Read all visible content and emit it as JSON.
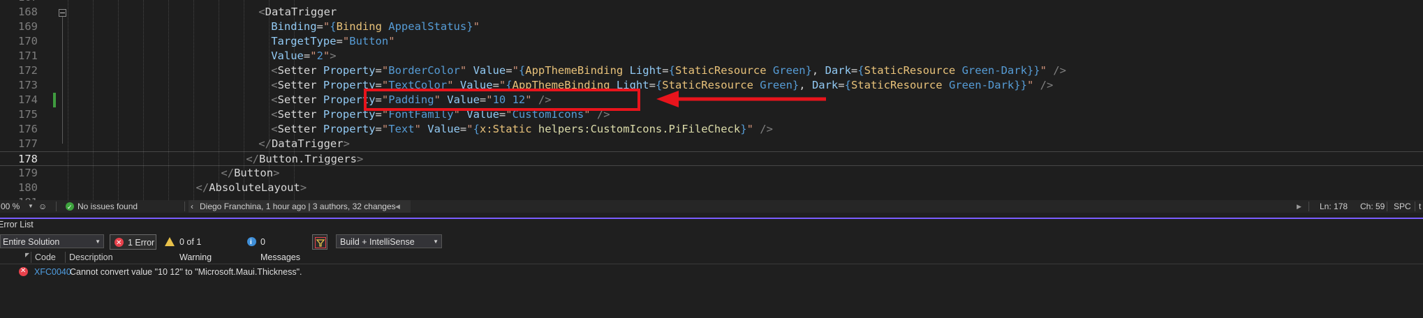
{
  "editor": {
    "lines": [
      {
        "num": "168",
        "indent": 30,
        "tokens": [
          [
            "br",
            "<"
          ],
          [
            "tag",
            "DataTrigger"
          ]
        ]
      },
      {
        "num": "169",
        "indent": 32,
        "tokens": [
          [
            "at",
            "Binding"
          ],
          [
            "eq",
            "="
          ],
          [
            "q",
            "\""
          ],
          [
            "str",
            "{"
          ],
          [
            "ext",
            "Binding"
          ],
          [
            "str",
            " AppealStatus}"
          ],
          [
            "q",
            "\""
          ]
        ]
      },
      {
        "num": "170",
        "indent": 32,
        "tokens": [
          [
            "at",
            "TargetType"
          ],
          [
            "eq",
            "="
          ],
          [
            "q",
            "\""
          ],
          [
            "str",
            "Button"
          ],
          [
            "q",
            "\""
          ]
        ]
      },
      {
        "num": "171",
        "indent": 32,
        "tokens": [
          [
            "at",
            "Value"
          ],
          [
            "eq",
            "="
          ],
          [
            "q",
            "\""
          ],
          [
            "str",
            "2"
          ],
          [
            "q",
            "\""
          ],
          [
            "br",
            ">"
          ]
        ]
      },
      {
        "num": "172",
        "indent": 32,
        "tokens": [
          [
            "br",
            "<"
          ],
          [
            "tag",
            "Setter "
          ],
          [
            "at",
            "Property"
          ],
          [
            "eq",
            "="
          ],
          [
            "q",
            "\""
          ],
          [
            "str",
            "BorderColor"
          ],
          [
            "q",
            "\""
          ],
          [
            "at",
            " Value"
          ],
          [
            "eq",
            "="
          ],
          [
            "q",
            "\""
          ],
          [
            "str",
            "{"
          ],
          [
            "ext",
            "AppThemeBinding"
          ],
          [
            "at",
            " Light"
          ],
          [
            "eq",
            "="
          ],
          [
            "str",
            "{"
          ],
          [
            "ext",
            "StaticResource"
          ],
          [
            "str",
            " Green}"
          ],
          [
            "eq",
            ", "
          ],
          [
            "at",
            "Dark"
          ],
          [
            "eq",
            "="
          ],
          [
            "str",
            "{"
          ],
          [
            "ext",
            "StaticResource"
          ],
          [
            "str",
            " Green-Dark}}"
          ],
          [
            "q",
            "\""
          ],
          [
            "br",
            " />"
          ]
        ]
      },
      {
        "num": "173",
        "indent": 32,
        "tokens": [
          [
            "br",
            "<"
          ],
          [
            "tag",
            "Setter "
          ],
          [
            "at",
            "Property"
          ],
          [
            "eq",
            "="
          ],
          [
            "q",
            "\""
          ],
          [
            "str",
            "TextColor"
          ],
          [
            "q",
            "\""
          ],
          [
            "at",
            " Value"
          ],
          [
            "eq",
            "="
          ],
          [
            "q",
            "\""
          ],
          [
            "str",
            "{"
          ],
          [
            "ext",
            "AppThemeBinding"
          ],
          [
            "at",
            " Light"
          ],
          [
            "eq",
            "="
          ],
          [
            "str",
            "{"
          ],
          [
            "ext",
            "StaticResource"
          ],
          [
            "str",
            " Green}"
          ],
          [
            "eq",
            ", "
          ],
          [
            "at",
            "Dark"
          ],
          [
            "eq",
            "="
          ],
          [
            "str",
            "{"
          ],
          [
            "ext",
            "StaticResource"
          ],
          [
            "str",
            " Green-Dark}}"
          ],
          [
            "q",
            "\""
          ],
          [
            "br",
            " />"
          ]
        ]
      },
      {
        "num": "174",
        "indent": 32,
        "tokens": [
          [
            "br",
            "<"
          ],
          [
            "tag",
            "Setter "
          ],
          [
            "at",
            "Property"
          ],
          [
            "eq",
            "="
          ],
          [
            "q",
            "\""
          ],
          [
            "str",
            "Padding"
          ],
          [
            "q",
            "\""
          ],
          [
            "at",
            " Value"
          ],
          [
            "eq",
            "="
          ],
          [
            "q",
            "\""
          ],
          [
            "str",
            "10 12"
          ],
          [
            "q",
            "\""
          ],
          [
            "br",
            " />"
          ]
        ]
      },
      {
        "num": "175",
        "indent": 32,
        "tokens": [
          [
            "br",
            "<"
          ],
          [
            "tag",
            "Setter "
          ],
          [
            "at",
            "Property"
          ],
          [
            "eq",
            "="
          ],
          [
            "q",
            "\""
          ],
          [
            "str",
            "FontFamily"
          ],
          [
            "q",
            "\""
          ],
          [
            "at",
            " Value"
          ],
          [
            "eq",
            "="
          ],
          [
            "q",
            "\""
          ],
          [
            "str",
            "CustomIcons"
          ],
          [
            "q",
            "\""
          ],
          [
            "br",
            " />"
          ]
        ]
      },
      {
        "num": "176",
        "indent": 32,
        "tokens": [
          [
            "br",
            "<"
          ],
          [
            "tag",
            "Setter "
          ],
          [
            "at",
            "Property"
          ],
          [
            "eq",
            "="
          ],
          [
            "q",
            "\""
          ],
          [
            "str",
            "Text"
          ],
          [
            "q",
            "\""
          ],
          [
            "at",
            " Value"
          ],
          [
            "eq",
            "="
          ],
          [
            "q",
            "\""
          ],
          [
            "str",
            "{"
          ],
          [
            "ext",
            "x:Static"
          ],
          [
            "ext2",
            " helpers:CustomIcons.PiFileCheck"
          ],
          [
            "str",
            "}"
          ],
          [
            "q",
            "\""
          ],
          [
            "br",
            " />"
          ]
        ]
      },
      {
        "num": "177",
        "indent": 30,
        "tokens": [
          [
            "br",
            "</"
          ],
          [
            "tag",
            "DataTrigger"
          ],
          [
            "br",
            ">"
          ]
        ]
      },
      {
        "num": "178",
        "indent": 28,
        "tokens": [
          [
            "br",
            "</"
          ],
          [
            "tag",
            "Button.Triggers"
          ],
          [
            "br",
            ">"
          ]
        ]
      },
      {
        "num": "179",
        "indent": 24,
        "tokens": [
          [
            "br",
            "</"
          ],
          [
            "tag",
            "Button"
          ],
          [
            "br",
            ">"
          ]
        ]
      },
      {
        "num": "180",
        "indent": 20,
        "tokens": [
          [
            "br",
            "</"
          ],
          [
            "tag",
            "AbsoluteLayout"
          ],
          [
            "br",
            ">"
          ]
        ]
      }
    ],
    "partial_top_num": "167",
    "partial_bottom_num": "181",
    "current_line": "178"
  },
  "statusbar": {
    "zoom": "00 %",
    "issues": "No issues found",
    "git_info": "Diego Franchina, 1 hour ago | 3 authors, 32 changes",
    "ln": "Ln: 178",
    "ch": "Ch: 59",
    "spc": "SPC",
    "tail": "t"
  },
  "error_list": {
    "title": "Error List",
    "scope": "Entire Solution",
    "errors_btn": "1 Error",
    "warnings_btn": "0 of 1 Warning",
    "messages_btn": "0 Messages",
    "build_filter": "Build + IntelliSense",
    "columns": {
      "code": "Code",
      "description": "Description"
    },
    "rows": [
      {
        "code": "XFC0040",
        "description": "Cannot convert value \"10 12\" to \"Microsoft.Maui.Thickness\"."
      }
    ]
  },
  "colors": {
    "accent_divider": "#7a5cff",
    "annotation_red": "#e8141c",
    "error_red": "#e8414b",
    "link_blue": "#4f9de0"
  }
}
